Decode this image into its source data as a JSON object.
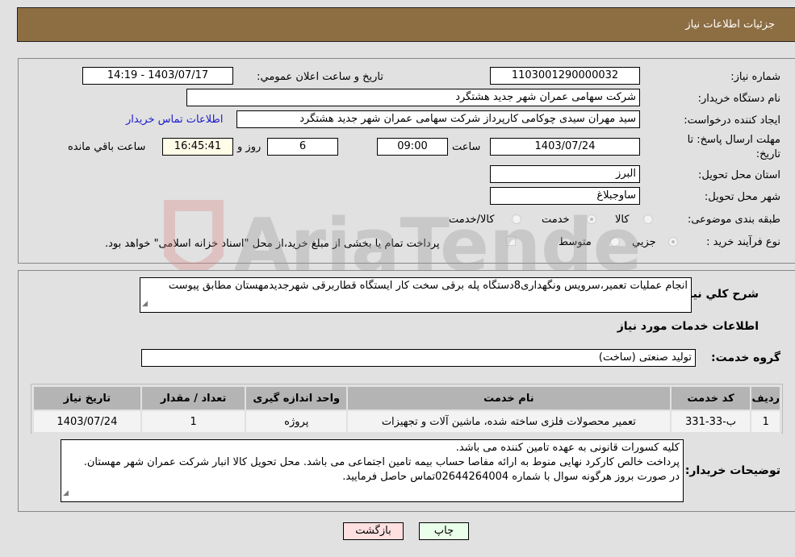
{
  "header": {
    "title": "جزئیات اطلاعات نیاز"
  },
  "fields": {
    "need_number_label": "شماره نیاز:",
    "need_number": "1103001290000032",
    "announce_label": "تاریخ و ساعت اعلان عمومي:",
    "announce_value": "1403/07/17 - 14:19",
    "buyer_org_label": "نام دستگاه خریدار:",
    "buyer_org": "شرکت سهامی عمران شهر جدید هشتگرد",
    "creator_label": "ایجاد کننده درخواست:",
    "creator": "سید مهران سیدی چوکامی کارپرداز شرکت سهامی عمران شهر جدید هشتگرد",
    "contact_link": "اطلاعات تماس خریدار",
    "deadline_label_1": "مهلت ارسال پاسخ: تا",
    "deadline_label_2": "تاریخ:",
    "deadline_date": "1403/07/24",
    "time_label": "ساعت",
    "deadline_time": "09:00",
    "days_value": "6",
    "days_label": "روز و",
    "remaining_time": "16:45:41",
    "remaining_label": "ساعت باقي مانده",
    "province_label": "استان محل تحویل:",
    "province": "البرز",
    "city_label": "شهر محل تحویل:",
    "city": "ساوجبلاغ",
    "category_label": "طبقه بندی موضوعی:",
    "category_options": [
      "کالا",
      "خدمت",
      "کالا/خدمت"
    ],
    "category_selected": "خدمت",
    "process_label": "نوع فرآیند خرید :",
    "process_options": [
      "جزيي",
      "متوسط"
    ],
    "process_selected": "جزيي",
    "treasury_text": "پرداخت تمام یا بخشی از مبلغ خرید،از محل \"اسناد خزانه اسلامی\" خواهد بود."
  },
  "description": {
    "label": "شرح کلي نیاز:",
    "text": "انجام عملیات تعمیر،سرویس ونگهداری8دستگاه پله برقی سخت کار ایستگاه قطاربرقی شهرجدیدمهستان مطابق پیوست"
  },
  "services_section": {
    "title": "اطلاعات خدمات مورد نیاز",
    "group_label": "گروه خدمت:",
    "group_value": "تولید صنعتی (ساخت)"
  },
  "table": {
    "headers": [
      "ردیف",
      "کد خدمت",
      "نام خدمت",
      "واحد اندازه گیری",
      "تعداد / مقدار",
      "تاریخ نیاز"
    ],
    "rows": [
      [
        "1",
        "ب-33-331",
        "تعمیر محصولات فلزی ساخته شده، ماشین آلات و تجهیزات",
        "پروژه",
        "1",
        "1403/07/24"
      ]
    ]
  },
  "buyer_notes": {
    "label": "توضیحات خریدار:",
    "lines": [
      "کلیه کسورات قانونی به عهده تامین کننده می باشد.",
      "پرداخت خالص کارکرد نهایی منوط به ارائه مفاصا حساب بیمه تامین اجتماعی می باشد. محل تحویل کالا انبار شرکت عمران شهر مهستان.",
      "در صورت بروز هرگونه سوال با شماره 02644264004تماس حاصل فرمایید."
    ]
  },
  "buttons": {
    "back": "بازگشت",
    "print": "چاپ"
  },
  "watermark": {
    "text": "AriaTender.neT"
  }
}
